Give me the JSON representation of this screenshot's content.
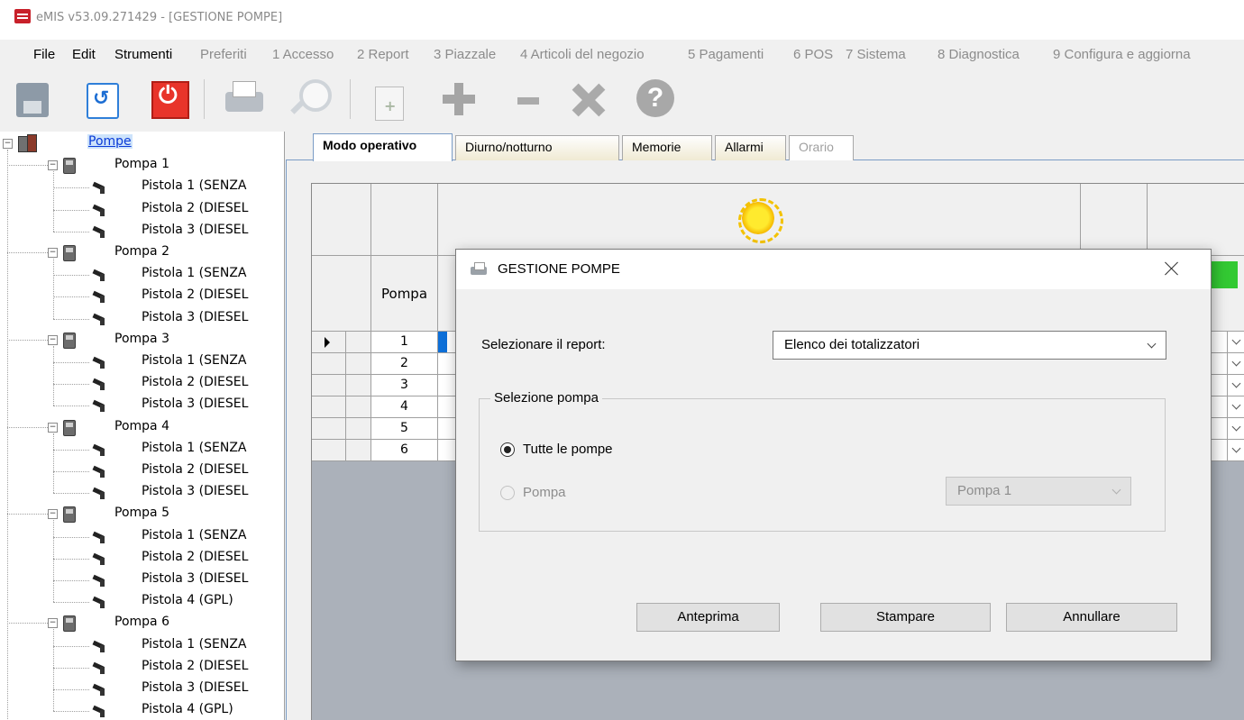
{
  "window": {
    "title": "eMIS v53.09.271429 - [GESTIONE POMPE]"
  },
  "menu": [
    {
      "label": "File",
      "enabled": true
    },
    {
      "label": "Edit",
      "enabled": true
    },
    {
      "label": "Strumenti",
      "enabled": true
    },
    {
      "label": "Preferiti",
      "enabled": false
    },
    {
      "label": "1 Accesso",
      "enabled": false
    },
    {
      "label": "2 Report",
      "enabled": false
    },
    {
      "label": "3 Piazzale",
      "enabled": false
    },
    {
      "label": "4 Articoli del negozio",
      "enabled": false
    },
    {
      "label": "5 Pagamenti",
      "enabled": false
    },
    {
      "label": "6 POS",
      "enabled": false
    },
    {
      "label": "7 Sistema",
      "enabled": false
    },
    {
      "label": "8 Diagnostica",
      "enabled": false
    },
    {
      "label": "9 Configura e aggiorna",
      "enabled": false
    }
  ],
  "toolbar": {
    "icons": [
      "save-icon",
      "undo-icon",
      "power-icon",
      "printer-icon",
      "search-icon",
      "new-document-icon",
      "add-icon",
      "remove-icon",
      "tools-icon",
      "help-icon"
    ]
  },
  "tree": {
    "root": "Pompe",
    "pumps": [
      {
        "label": "Pompa 1",
        "nozzles": [
          "Pistola 1 (SENZA",
          "Pistola 2 (DIESEL",
          "Pistola 3 (DIESEL"
        ]
      },
      {
        "label": "Pompa 2",
        "nozzles": [
          "Pistola 1 (SENZA",
          "Pistola 2 (DIESEL",
          "Pistola 3 (DIESEL"
        ]
      },
      {
        "label": "Pompa 3",
        "nozzles": [
          "Pistola 1 (SENZA",
          "Pistola 2 (DIESEL",
          "Pistola 3 (DIESEL"
        ]
      },
      {
        "label": "Pompa 4",
        "nozzles": [
          "Pistola 1 (SENZA",
          "Pistola 2 (DIESEL",
          "Pistola 3 (DIESEL"
        ]
      },
      {
        "label": "Pompa 5",
        "nozzles": [
          "Pistola 1 (SENZA",
          "Pistola 2 (DIESEL",
          "Pistola 3 (DIESEL",
          "Pistola 4 (GPL)"
        ]
      },
      {
        "label": "Pompa 6",
        "nozzles": [
          "Pistola 1 (SENZA",
          "Pistola 2 (DIESEL",
          "Pistola 3 (DIESEL",
          "Pistola 4 (GPL)"
        ]
      }
    ]
  },
  "tabs": [
    {
      "label": "Modo operativo",
      "state": "active"
    },
    {
      "label": "Diurno/notturno",
      "state": "inactive"
    },
    {
      "label": "Memorie",
      "state": "inactive"
    },
    {
      "label": "Allarmi",
      "state": "inactive"
    },
    {
      "label": "Orario",
      "state": "disabled"
    }
  ],
  "grid": {
    "header_label": "Pompa",
    "rows": [
      "1",
      "2",
      "3",
      "4",
      "5",
      "6"
    ],
    "mode_icon": "sun-icon",
    "status_color": "#33c933"
  },
  "dialog": {
    "title": "GESTIONE POMPE",
    "report_label": "Selezionare il report:",
    "report_value": "Elenco dei totalizzatori",
    "group_title": "Selezione pompa",
    "radio_all": "Tutte le pompe",
    "radio_one": "Pompa",
    "pump_select_value": "Pompa 1",
    "buttons": {
      "preview": "Anteprima",
      "print": "Stampare",
      "cancel": "Annullare"
    }
  },
  "colors": {
    "accent": "#0a3bd7",
    "tab_border": "#7a9cc6",
    "power": "#e8342a"
  }
}
